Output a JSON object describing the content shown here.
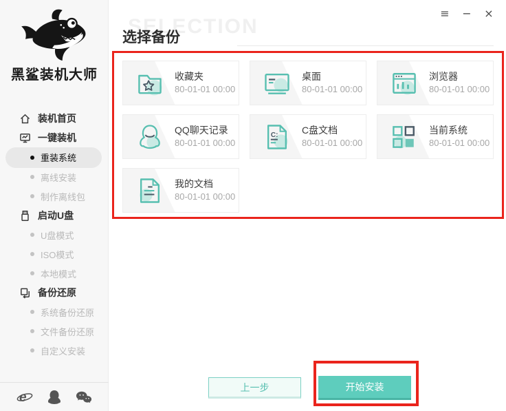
{
  "window": {
    "controls": {
      "menu": "≡",
      "minimize": "−",
      "close": "×"
    }
  },
  "sidebar": {
    "brand": "黑鲨装机大师",
    "logo_icon": "shark-logo",
    "items": [
      {
        "label": "装机首页",
        "type": "section",
        "icon": "home-icon",
        "active": false
      },
      {
        "label": "一键装机",
        "type": "section",
        "icon": "onekey-monitor-icon",
        "active": false
      },
      {
        "label": "重装系统",
        "type": "sub",
        "active": true
      },
      {
        "label": "离线安装",
        "type": "sub",
        "active": false
      },
      {
        "label": "制作离线包",
        "type": "sub",
        "active": false
      },
      {
        "label": "启动U盘",
        "type": "section",
        "icon": "usb-drive-icon",
        "active": false
      },
      {
        "label": "U盘模式",
        "type": "sub",
        "active": false
      },
      {
        "label": "ISO模式",
        "type": "sub",
        "active": false
      },
      {
        "label": "本地模式",
        "type": "sub",
        "active": false
      },
      {
        "label": "备份还原",
        "type": "section",
        "icon": "backup-restore-icon",
        "active": false
      },
      {
        "label": "系统备份还原",
        "type": "sub",
        "active": false
      },
      {
        "label": "文件备份还原",
        "type": "sub",
        "active": false
      },
      {
        "label": "自定义安装",
        "type": "sub",
        "active": false
      }
    ],
    "footer_icons": [
      "ie-browser-icon",
      "qq-icon",
      "wechat-icon"
    ]
  },
  "main": {
    "watermark": "SELECTION",
    "title": "选择备份",
    "cards": [
      {
        "label": "收藏夹",
        "date": "80-01-01 00:00",
        "icon": "favorites-folder-icon"
      },
      {
        "label": "桌面",
        "date": "80-01-01 00:00",
        "icon": "desktop-icon"
      },
      {
        "label": "浏览器",
        "date": "80-01-01 00:00",
        "icon": "browser-icon"
      },
      {
        "label": "QQ聊天记录",
        "date": "80-01-01 00:00",
        "icon": "qq-penguin-icon"
      },
      {
        "label": "C盘文档",
        "date": "80-01-01 00:00",
        "icon": "c-drive-document-icon"
      },
      {
        "label": "当前系统",
        "date": "80-01-01 00:00",
        "icon": "current-system-icon"
      },
      {
        "label": "我的文档",
        "date": "80-01-01 00:00",
        "icon": "my-documents-icon"
      }
    ],
    "footer": {
      "prev_label": "上一步",
      "start_label": "开始安装"
    }
  },
  "annotations": {
    "color": "#ea241c",
    "regions": [
      "backup-cards-grid",
      "start-install-button"
    ]
  },
  "colors": {
    "accent_teal": "#5ecdbd",
    "teal_stroke": "#57bfb0",
    "teal_light": "#c9eae4",
    "dark_slate": "#4a5a66",
    "sidebar_bg": "#f7f7f7",
    "annotation_red": "#ea241c"
  }
}
